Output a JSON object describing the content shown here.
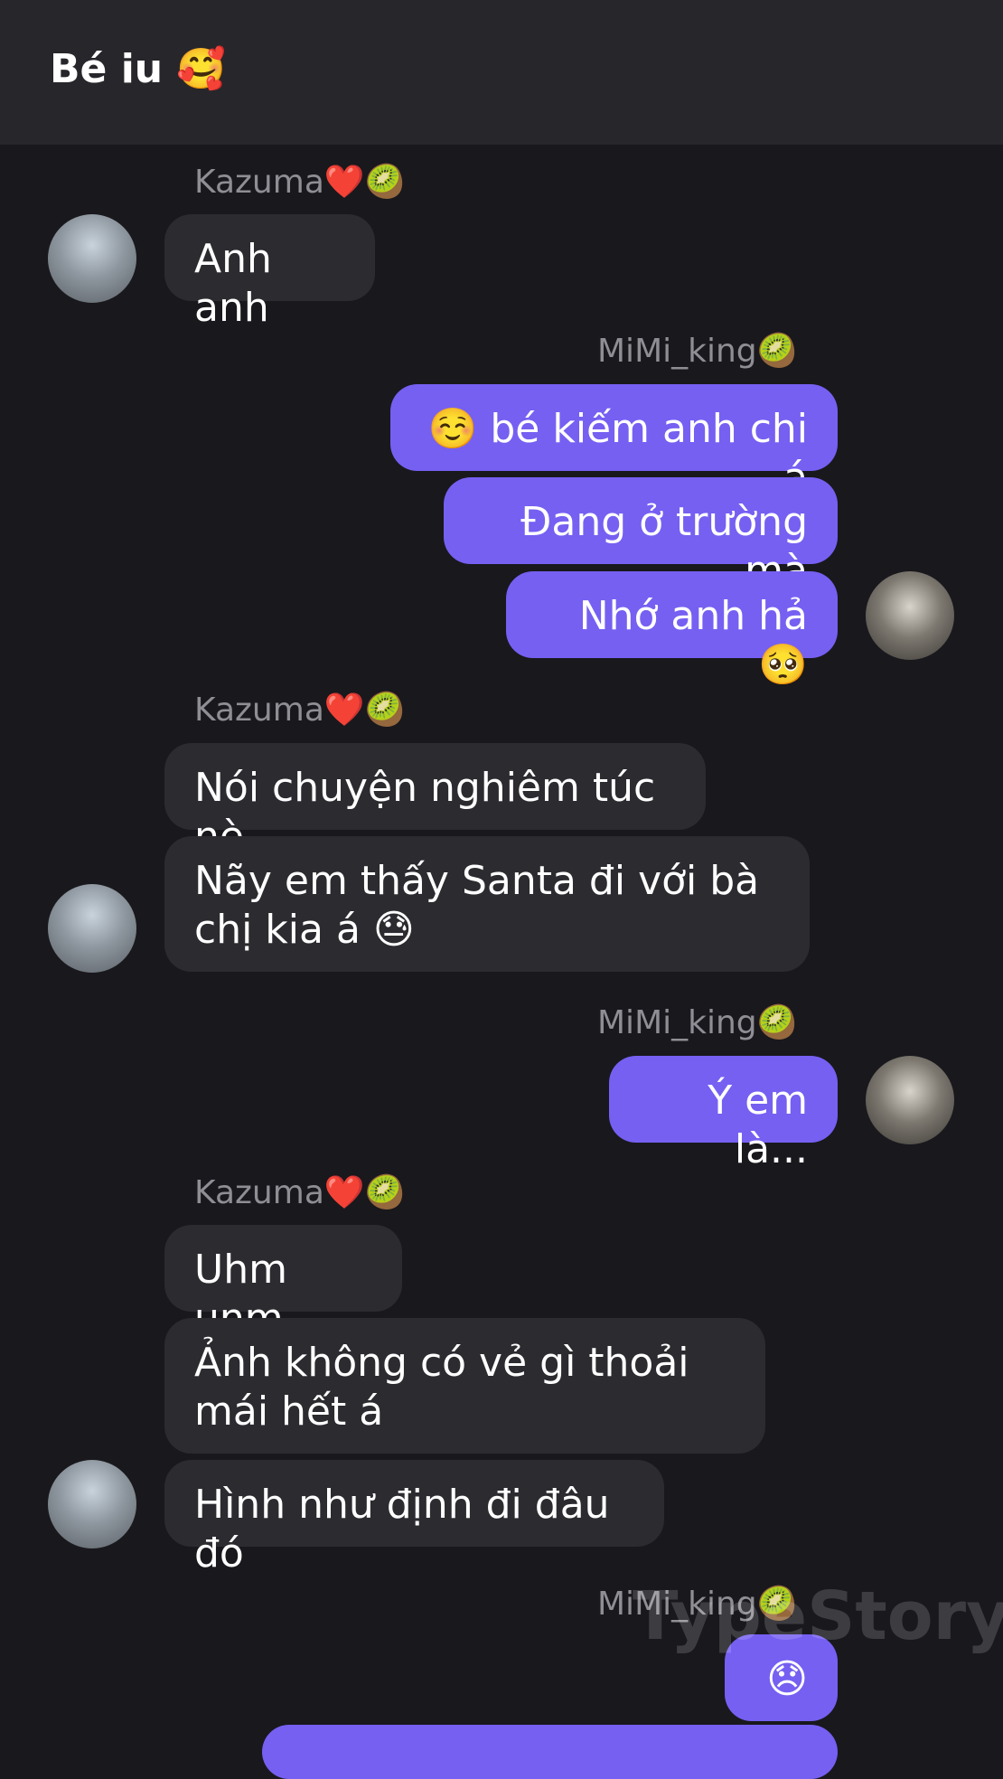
{
  "header": {
    "title": "Bé iu 🥰"
  },
  "messages": {
    "kazuma_name": "Kazuma❤️🥝",
    "mimi_name": "MiMi_king🥝",
    "m1": "Anh anh",
    "m2": "☺️ bé kiếm anh chi á",
    "m3": "Đang ở trường mà",
    "m4": "Nhớ anh hả 🥺",
    "m5": "Nói chuyện nghiêm túc nè",
    "m6": "Nãy em thấy Santa đi với bà chị kia á 😓",
    "m7": "Ý em là...",
    "m8": "Uhm unm",
    "m9": "Ảnh không có vẻ gì thoải mái hết á",
    "m10": "Hình như định đi đâu đó",
    "m11": "😞"
  },
  "watermark": "TypeStory"
}
